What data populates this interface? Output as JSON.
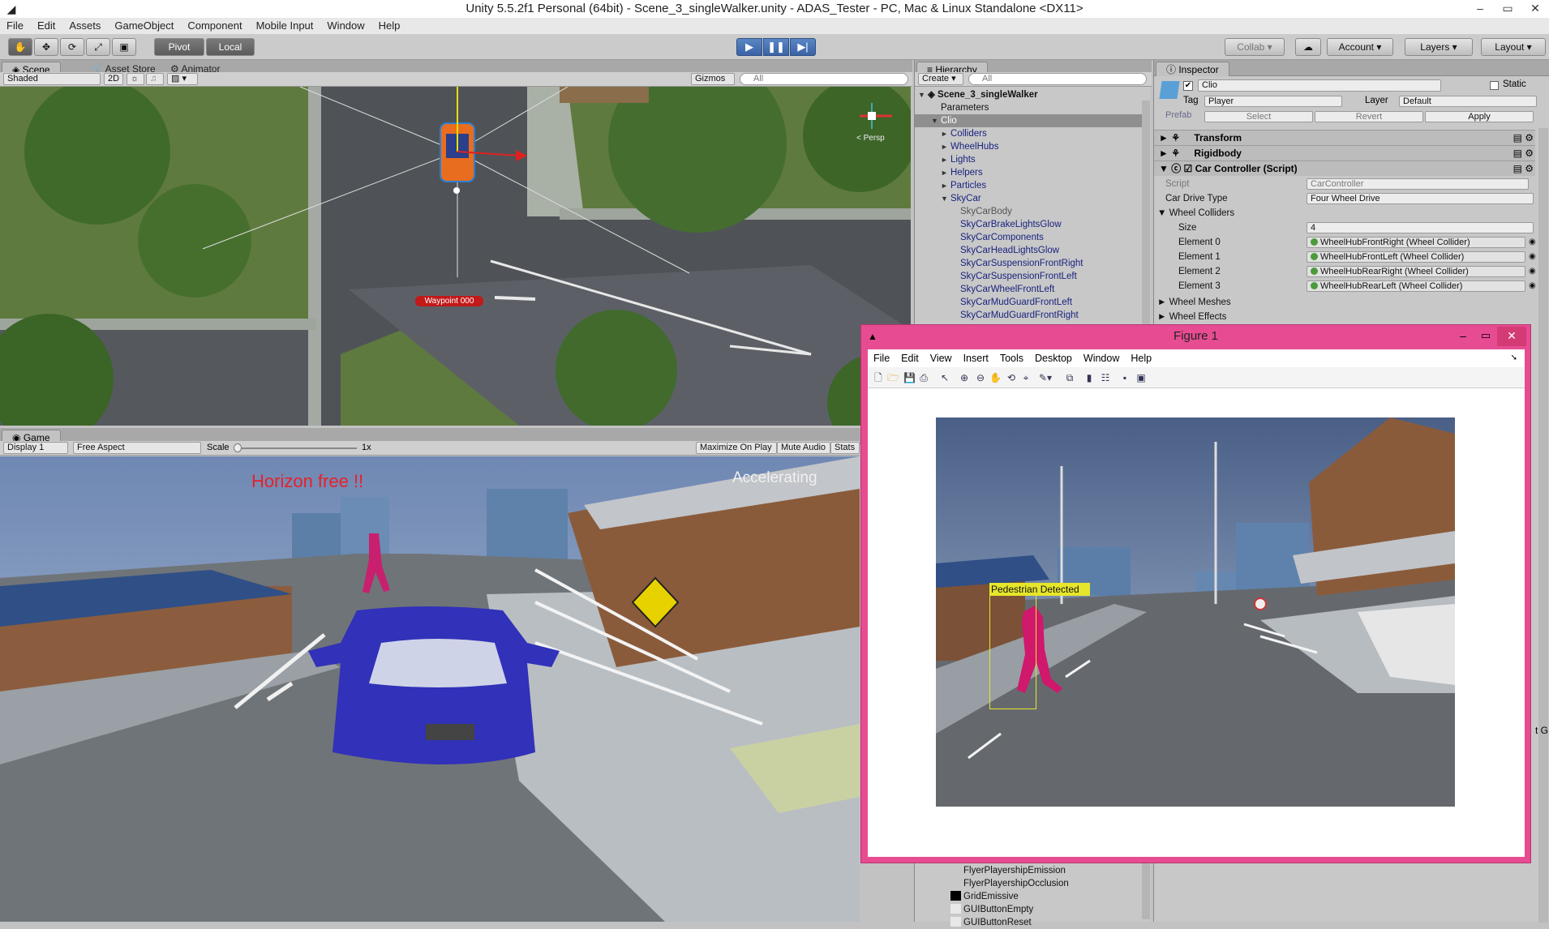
{
  "window": {
    "title": "Unity 5.5.2f1 Personal (64bit) - Scene_3_singleWalker.unity - ADAS_Tester - PC, Mac & Linux Standalone <DX11>",
    "controls": [
      "–",
      "▭",
      "✕"
    ]
  },
  "menubar": [
    "File",
    "Edit",
    "Assets",
    "GameObject",
    "Component",
    "Mobile Input",
    "Window",
    "Help"
  ],
  "toolbar": {
    "tools": [
      "hand-tool",
      "move-tool",
      "rotate-tool",
      "scale-tool",
      "rect-tool"
    ],
    "pivot_label": "Pivot",
    "local_label": "Local",
    "collab_label": "Collab ▾",
    "account_label": "Account",
    "layers_label": "Layers",
    "layout_label": "Layout"
  },
  "scene": {
    "tabs": [
      "Scene",
      "Asset Store",
      "Animator"
    ],
    "shading": "Shaded",
    "mode_2d": "2D",
    "gizmos": "Gizmos",
    "search_placeholder": "All",
    "persp_label": "< Persp",
    "waypoint_label": "Waypoint 000"
  },
  "game": {
    "tab": "Game",
    "display": "Display 1",
    "aspect": "Free Aspect",
    "scale_label": "Scale",
    "scale_value": "1x",
    "scale_level": 0.02,
    "maximize": "Maximize On Play",
    "mute": "Mute Audio",
    "stats": "Stats",
    "hud_horizon": "Horizon free !!",
    "hud_state": "Accelerating"
  },
  "hierarchy": {
    "tab": "Hierarchy",
    "create": "Create ▾",
    "search_placeholder": "All",
    "scene_name": "Scene_3_singleWalker",
    "items": [
      {
        "label": "Parameters",
        "indent": 1,
        "arrow": ""
      },
      {
        "label": "Clio",
        "indent": 1,
        "arrow": "▼",
        "selected": true
      },
      {
        "label": "Colliders",
        "indent": 2,
        "arrow": "►"
      },
      {
        "label": "WheelHubs",
        "indent": 2,
        "arrow": "►"
      },
      {
        "label": "Lights",
        "indent": 2,
        "arrow": "►"
      },
      {
        "label": "Helpers",
        "indent": 2,
        "arrow": "►"
      },
      {
        "label": "Particles",
        "indent": 2,
        "arrow": "►"
      },
      {
        "label": "SkyCar",
        "indent": 2,
        "arrow": "▼"
      },
      {
        "label": "SkyCarBody",
        "indent": 3,
        "arrow": "",
        "dim": true
      },
      {
        "label": "SkyCarBrakeLightsGlow",
        "indent": 3,
        "arrow": ""
      },
      {
        "label": "SkyCarComponents",
        "indent": 3,
        "arrow": ""
      },
      {
        "label": "SkyCarHeadLightsGlow",
        "indent": 3,
        "arrow": ""
      },
      {
        "label": "SkyCarSuspensionFrontRight",
        "indent": 3,
        "arrow": ""
      },
      {
        "label": "SkyCarSuspensionFrontLeft",
        "indent": 3,
        "arrow": ""
      },
      {
        "label": "SkyCarWheelFrontLeft",
        "indent": 3,
        "arrow": ""
      },
      {
        "label": "SkyCarMudGuardFrontLeft",
        "indent": 3,
        "arrow": ""
      },
      {
        "label": "SkyCarMudGuardFrontRight",
        "indent": 3,
        "arrow": ""
      }
    ],
    "bottom_items": [
      "FlyerPlayershipEmission",
      "FlyerPlayershipOcclusion",
      "GridEmissive",
      "GUIButtonEmpty",
      "GUIButtonReset"
    ]
  },
  "inspector": {
    "tab": "Inspector",
    "object_name": "Clio",
    "static_label": "Static",
    "tag_label": "Tag",
    "tag_value": "Player",
    "layer_label": "Layer",
    "layer_value": "Default",
    "prefab_label": "Prefab",
    "prefab_select": "Select",
    "prefab_revert": "Revert",
    "prefab_apply": "Apply",
    "components": [
      "Transform",
      "Rigidbody",
      "Car Controller (Script)"
    ],
    "script_label": "Script",
    "script_value": "CarController",
    "drive_label": "Car Drive Type",
    "drive_value": "Four Wheel Drive",
    "wheel_colliders_label": "Wheel Colliders",
    "size_label": "Size",
    "size_value": "4",
    "elements": [
      {
        "label": "Element 0",
        "value": "WheelHubFrontRight (Wheel Collider)"
      },
      {
        "label": "Element 1",
        "value": "WheelHubFrontLeft (Wheel Collider)"
      },
      {
        "label": "Element 2",
        "value": "WheelHubRearRight (Wheel Collider)"
      },
      {
        "label": "Element 3",
        "value": "WheelHubRearLeft (Wheel Collider)"
      }
    ],
    "wheel_meshes_label": "Wheel Meshes",
    "wheel_effects_label": "Wheel Effects",
    "edge_text": "t G"
  },
  "figure": {
    "title": "Figure 1",
    "menu": [
      "File",
      "Edit",
      "View",
      "Insert",
      "Tools",
      "Desktop",
      "Window",
      "Help"
    ],
    "detection_label": "Pedestrian Detected",
    "colors": {
      "frame": "#e74c92",
      "bbox": "#e6e62a",
      "pedestrian": "#d0186c"
    }
  }
}
